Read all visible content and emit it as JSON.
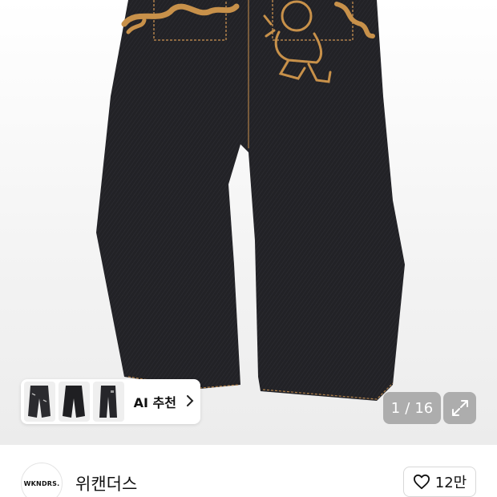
{
  "ai_recommend": {
    "label": "AI 추천",
    "chevron_icon": "chevron-right-icon",
    "thumbnails": [
      "jeans-thumbnail",
      "jeans-thumbnail",
      "jeans-thumbnail"
    ]
  },
  "gallery": {
    "current": "1",
    "separator": "/",
    "total": "16",
    "expand_icon": "expand-arrows-icon"
  },
  "brand": {
    "logo_text": "WKNDRS.",
    "name": "위캔더스"
  },
  "like": {
    "icon": "heart-outline-icon",
    "count": "12만"
  },
  "colors": {
    "denim": "#1f1f22",
    "embroidery": "#c8914a",
    "overlay": "#7a7a7a"
  }
}
